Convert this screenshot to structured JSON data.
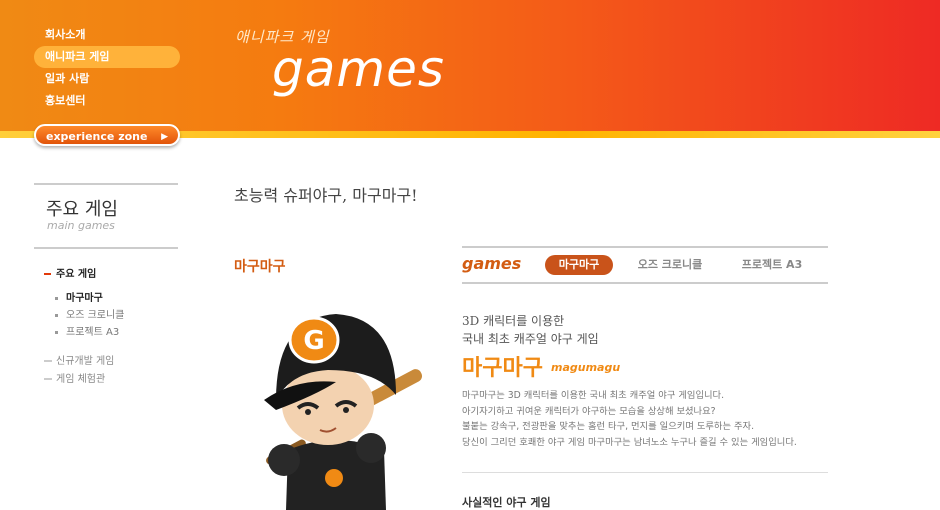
{
  "header": {
    "nav": [
      "회사소개",
      "애니파크 게임",
      "일과 사람",
      "홍보센터"
    ],
    "active_nav_index": 1,
    "experience_button": "experience zone",
    "brand_small": "애니파크 게임",
    "brand_big": "games"
  },
  "sidebar": {
    "title": "주요 게임",
    "subtitle": "main games",
    "main_item": "주요 게임",
    "sub_items": [
      "마구마구",
      "오즈 크로니클",
      "프로젝트 A3"
    ],
    "active_sub_index": 0,
    "other_items": [
      "신규개발 게임",
      "게임 체험관"
    ]
  },
  "main": {
    "headline": "초능력 슈퍼야구, 마구마구!",
    "game_title": "마구마구",
    "tabs_label": "games",
    "tabs": [
      "마구마구",
      "오즈 크로니클",
      "프로젝트 A3"
    ],
    "active_tab_index": 0,
    "copy_line1": "3D 캐릭터를 이용한",
    "copy_line2": "국내 최초 캐주얼 야구 게임",
    "game_name": "마구마구",
    "game_name_en": "magumagu",
    "description": [
      "마구마구는 3D 캐릭터를 이용한 국내 최초 캐주얼 야구 게임입니다.",
      "아기자기하고 귀여운 캐릭터가 야구하는 모습을 상상해 보셨나요?",
      "불붙는 강속구, 전광판을 맞추는 홈런 타구, 먼지를 일으키며 도루하는 주자.",
      "당신이 그리던 호쾌한 야구 게임 마구마구는 남녀노소 누구나 즐길 수 있는 게임입니다."
    ],
    "section_head": "사실적인 야구 게임"
  },
  "colors": {
    "accent": "#d35c12",
    "orange": "#f08a14",
    "tab_active": "#c9531a"
  }
}
